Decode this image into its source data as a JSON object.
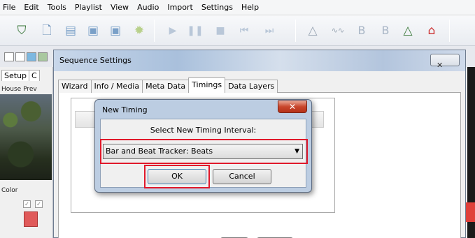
{
  "menu": [
    "File",
    "Edit",
    "Tools",
    "Playlist",
    "View",
    "Audio",
    "Import",
    "Settings",
    "Help"
  ],
  "toolbar_icons": [
    "filter-icon",
    "new-file-icon",
    "open-folder-icon",
    "save-icon",
    "save-as-icon",
    "settings-icon",
    "play-icon",
    "pause-icon",
    "stop-icon",
    "rewind-icon",
    "fast-forward-icon",
    "triangle-icon",
    "wave-icon",
    "b-icon",
    "b-icon",
    "tree-icon",
    "house-icon"
  ],
  "left_panel": {
    "tabs": [
      "Setup",
      "C"
    ],
    "preview_label": "House Prev",
    "color_label": "Color"
  },
  "sequence_settings": {
    "title": "Sequence Settings",
    "close_glyph": "✕",
    "tabs": [
      "Wizard",
      "Info / Media",
      "Meta Data",
      "Timings",
      "Data Layers"
    ],
    "active_tab": "Timings"
  },
  "new_timing": {
    "title": "New Timing",
    "close_glyph": "✕",
    "prompt": "Select New Timing Interval:",
    "selected_option": "Bar and Beat Tracker: Beats",
    "dropdown_arrow": "▼",
    "ok_label": "OK",
    "cancel_label": "Cancel"
  },
  "colors": {
    "highlight": "#e0192b",
    "title_gradient": "#a9c0dc",
    "close_red": "#c8452c"
  }
}
